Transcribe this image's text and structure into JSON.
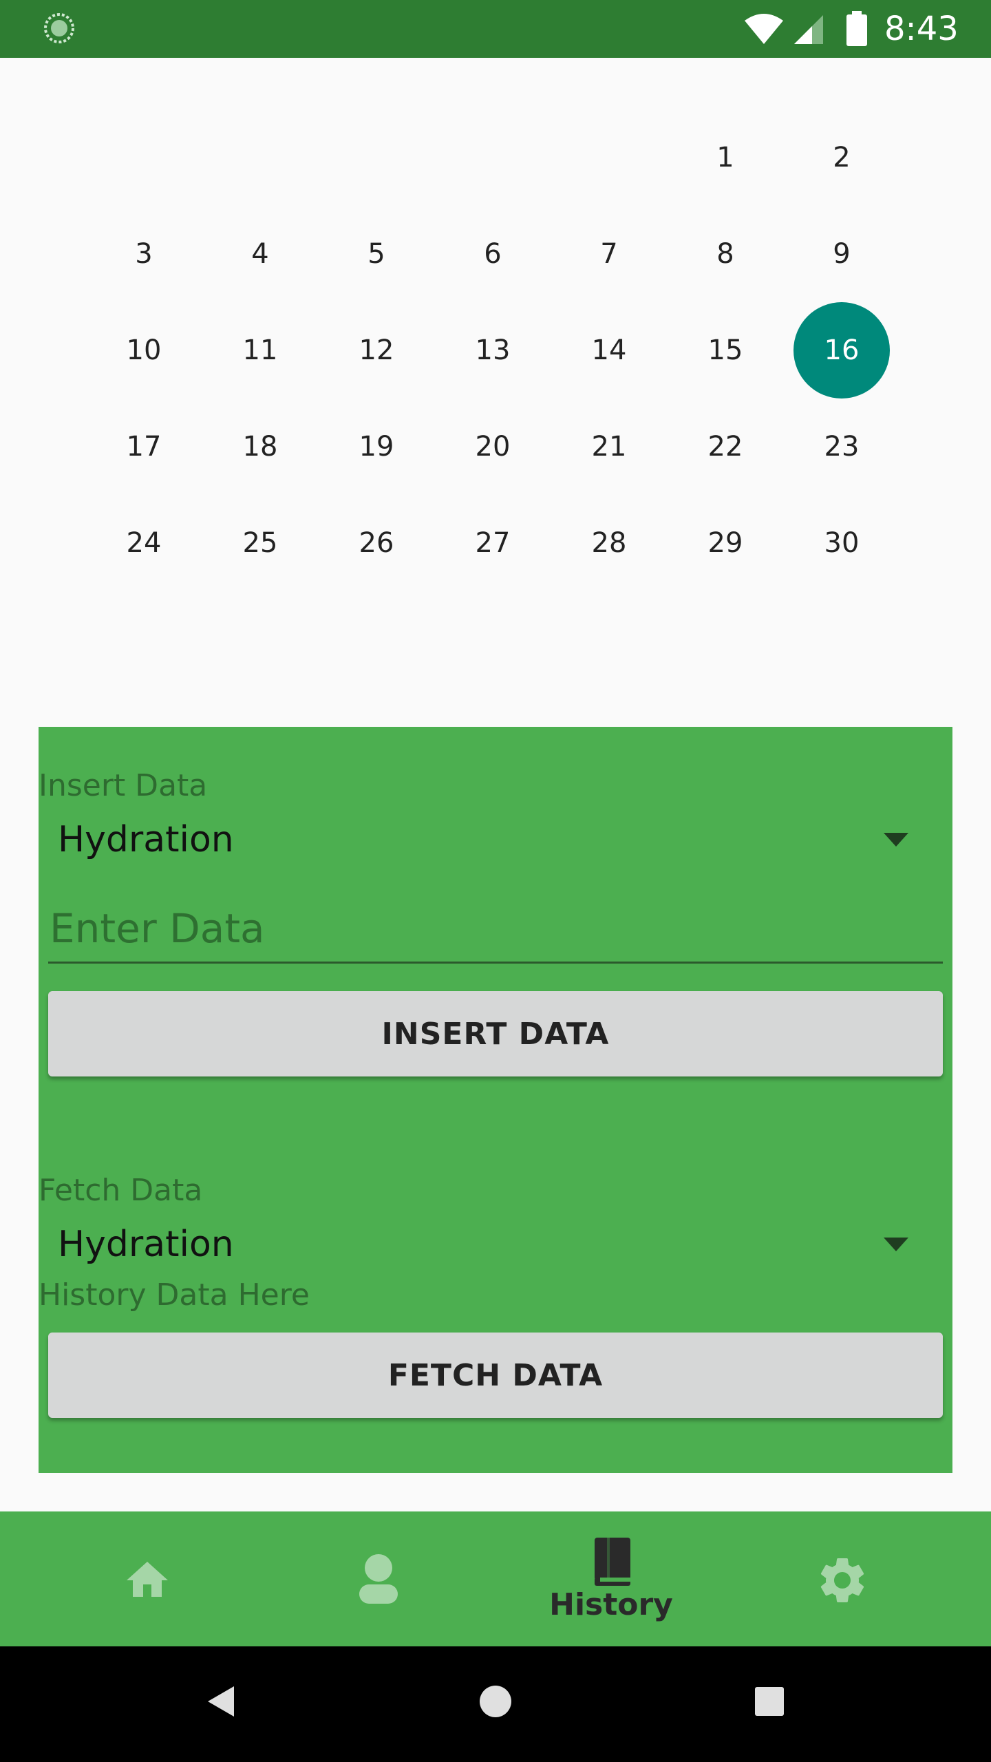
{
  "status_bar": {
    "time": "8:43"
  },
  "calendar": {
    "selected_day": "16",
    "weeks": [
      [
        "",
        "",
        "",
        "",
        "",
        "1",
        "2"
      ],
      [
        "3",
        "4",
        "5",
        "6",
        "7",
        "8",
        "9"
      ],
      [
        "10",
        "11",
        "12",
        "13",
        "14",
        "15",
        "16"
      ],
      [
        "17",
        "18",
        "19",
        "20",
        "21",
        "22",
        "23"
      ],
      [
        "24",
        "25",
        "26",
        "27",
        "28",
        "29",
        "30"
      ]
    ]
  },
  "insert_section": {
    "label": "Insert Data",
    "spinner_value": "Hydration",
    "input_placeholder": "Enter Data",
    "input_value": "",
    "button_label": "INSERT DATA"
  },
  "fetch_section": {
    "label": "Fetch Data",
    "spinner_value": "Hydration",
    "result_text": "History Data Here",
    "button_label": "FETCH DATA"
  },
  "bottom_nav": {
    "items": [
      {
        "icon": "home-icon",
        "label": ""
      },
      {
        "icon": "person-icon",
        "label": ""
      },
      {
        "icon": "book-icon",
        "label": "History",
        "active": true
      },
      {
        "icon": "gear-icon",
        "label": ""
      }
    ]
  },
  "colors": {
    "status_bar": "#2e7d32",
    "panel": "#4caf50",
    "selected_day": "#00897b",
    "nav_inactive_icon": "#a5d6a7",
    "nav_active": "#2a2a2a"
  }
}
